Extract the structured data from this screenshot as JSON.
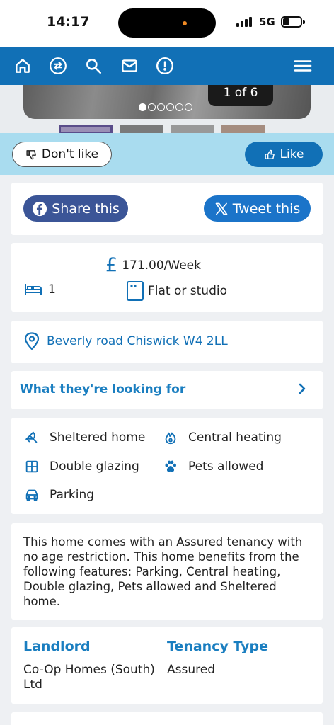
{
  "status_bar": {
    "time": "14:17",
    "network": "5G"
  },
  "nav": {
    "icons": [
      "home-icon",
      "swap-icon",
      "search-icon",
      "mail-icon",
      "alert-icon",
      "menu-icon"
    ]
  },
  "gallery": {
    "counter": "1 of 6",
    "total": 6,
    "current": 1
  },
  "likebar": {
    "dislike_label": "Don't like",
    "like_label": "Like"
  },
  "share": {
    "facebook_label": "Share this",
    "twitter_label": "Tweet this"
  },
  "summary": {
    "price": "171.00/Week",
    "bedrooms": "1",
    "property_type": "Flat or studio"
  },
  "address": "Beverly road Chiswick W4 2LL",
  "looking_for": {
    "title": "What they're looking for"
  },
  "features": {
    "sheltered": "Sheltered home",
    "heating": "Central heating",
    "glazing": "Double glazing",
    "pets": "Pets allowed",
    "parking": "Parking"
  },
  "description": "This home comes with an Assured tenancy with no age restriction. This home benefits from the following features: Parking, Central heating, Double glazing, Pets allowed and Sheltered home.",
  "info": {
    "landlord_label": "Landlord",
    "landlord_value": "Co-Op Homes (South) Ltd",
    "tenancy_label": "Tenancy Type",
    "tenancy_value": "Assured"
  },
  "colors": {
    "primary": "#1170b6",
    "likebar": "#a9dcef",
    "facebook": "#3b5597",
    "twitter": "#1b74c9",
    "heading": "#1a7ec0"
  }
}
